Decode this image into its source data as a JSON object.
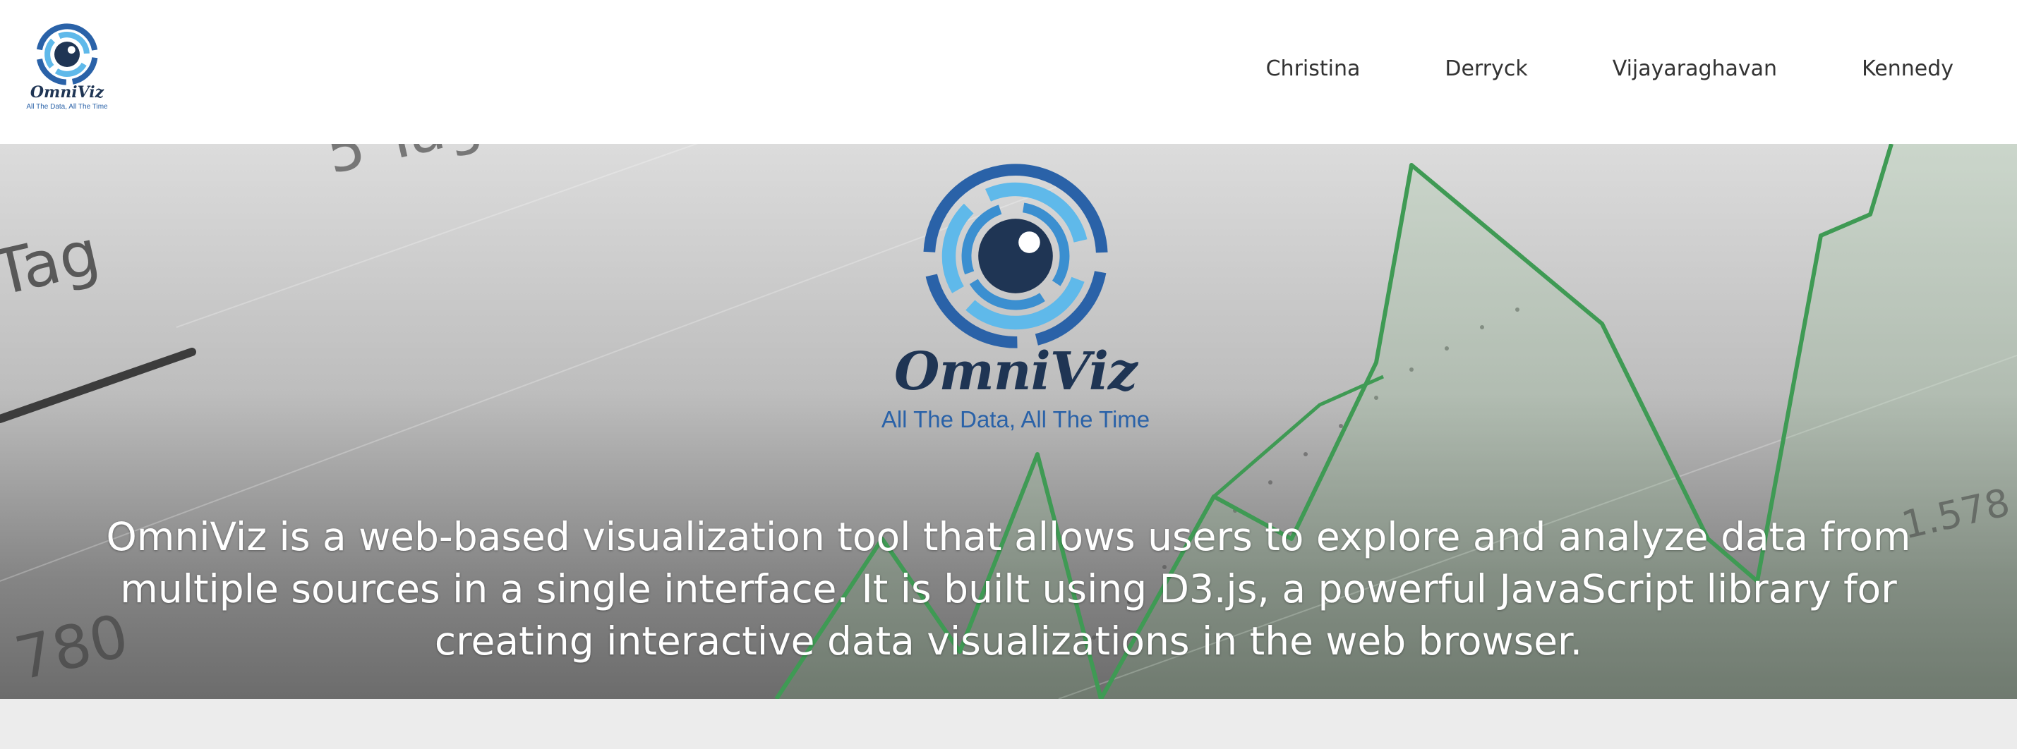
{
  "header": {
    "brand_name": "OmniViz",
    "brand_tagline": "All The Data, All The Time",
    "nav": [
      {
        "label": "Christina"
      },
      {
        "label": "Derryck"
      },
      {
        "label": "Vijayaraghavan"
      },
      {
        "label": "Kennedy"
      }
    ]
  },
  "hero": {
    "logo_name": "OmniViz",
    "logo_tagline": "All The Data, All The Time",
    "description": "OmniViz is a web-based visualization tool that allows users to explore and analyze data from multiple sources in a single interface. It is built using D3.js, a powerful JavaScript library for creating interactive data visualizations in the web browser.",
    "background_labels": {
      "tag_a": "5 Tag",
      "tag_b": "Tag",
      "value": "780",
      "right_value": "1.578"
    },
    "icon": "eye-logo-icon"
  },
  "colors": {
    "brand_dark": "#1f3554",
    "brand_blue": "#2a62a8",
    "ring_light": "#5fb9ea",
    "ring_mid": "#3b8fd0",
    "chart_green": "#3f9a54"
  }
}
